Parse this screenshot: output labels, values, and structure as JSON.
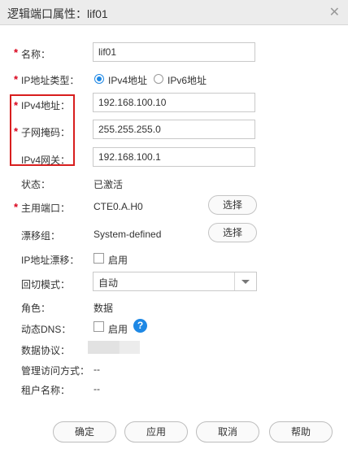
{
  "dialog": {
    "title": "逻辑端口属性：lif01",
    "close_glyph": "✕"
  },
  "fields": {
    "name": {
      "label": "名称：",
      "value": "lif01",
      "required": true
    },
    "ip_type": {
      "label": "IP地址类型：",
      "required": true,
      "options": [
        "IPv4地址",
        "IPv6地址"
      ],
      "selected": "IPv4地址"
    },
    "ipv4_addr": {
      "label": "IPv4地址：",
      "value": "192.168.100.10",
      "required": true
    },
    "netmask": {
      "label": "子网掩码：",
      "value": "255.255.255.0",
      "required": true
    },
    "gateway": {
      "label": "IPv4网关：",
      "value": "192.168.100.1"
    },
    "status": {
      "label": "状态：",
      "value": "已激活"
    },
    "home_port": {
      "label": "主用端口：",
      "value": "CTE0.A.H0",
      "button": "选择",
      "required": true
    },
    "failover_group": {
      "label": "漂移组：",
      "value": "System-defined",
      "button": "选择"
    },
    "ip_failover": {
      "label": "IP地址漂移：",
      "checkbox_label": "启用",
      "checked": false
    },
    "failback_mode": {
      "label": "回切模式：",
      "value": "自动"
    },
    "role": {
      "label": "角色：",
      "value": "数据"
    },
    "dynamic_dns": {
      "label": "动态DNS：",
      "checkbox_label": "启用",
      "checked": false,
      "help_glyph": "?"
    },
    "data_protocol": {
      "label": "数据协议："
    },
    "mgmt_access": {
      "label": "管理访问方式：",
      "value": "--"
    },
    "tenant_name": {
      "label": "租户名称：",
      "value": "--"
    }
  },
  "required_mark": "*",
  "footer": {
    "ok": "确定",
    "apply": "应用",
    "cancel": "取消",
    "help": "帮助"
  },
  "colors": {
    "required": "#d9001b",
    "highlight_box": "#d81e1e",
    "accent": "#1e88e5"
  }
}
